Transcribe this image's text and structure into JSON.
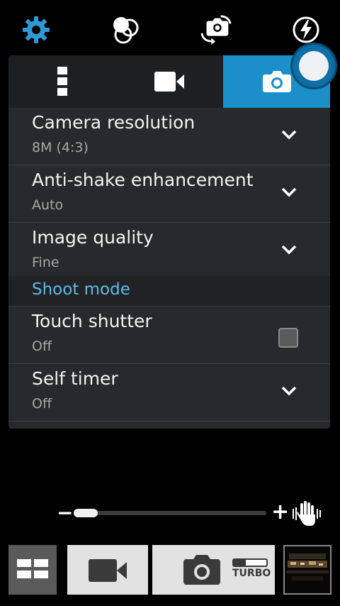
{
  "toolbar": {
    "settings_icon": "gear-icon",
    "effects_icon": "color-effects-icon",
    "switch_icon": "switch-camera-icon",
    "flash_icon": "flash-auto-icon"
  },
  "tabs": [
    {
      "name": "general-settings",
      "icon": "vertical-dots-icon"
    },
    {
      "name": "video-settings",
      "icon": "video-camera-icon"
    },
    {
      "name": "camera-settings",
      "icon": "camera-icon",
      "active": true
    }
  ],
  "settings": {
    "rows": [
      {
        "title": "Camera resolution",
        "value": "8M (4:3)"
      },
      {
        "title": "Anti-shake enhancement",
        "value": "Auto"
      },
      {
        "title": "Image quality",
        "value": "Fine"
      }
    ],
    "section_title": "Shoot mode",
    "rows2": [
      {
        "title": "Touch shutter",
        "value": "Off",
        "checked": false
      },
      {
        "title": "Self timer",
        "value": "Off"
      }
    ]
  },
  "zoom": {
    "minus": "−",
    "plus": "+",
    "level_fraction": 0.0
  },
  "bottom": {
    "turbo_label": "TURBO"
  },
  "colors": {
    "accent": "#1b8fc9",
    "section_text": "#5fb9e6"
  }
}
